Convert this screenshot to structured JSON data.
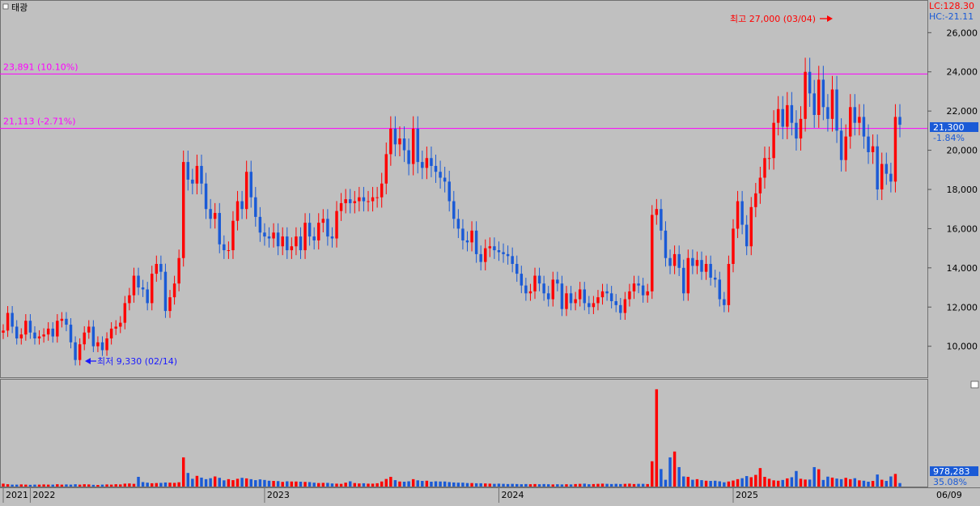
{
  "title": "태광",
  "top_right": {
    "lc": "LC:128.30",
    "hc": "HC:-21.11"
  },
  "current": {
    "price": "21,300",
    "change": "-1.84%"
  },
  "volume_label": "978,283",
  "volume_pct": "35.08%",
  "date_label": "06/09",
  "h_lines": [
    {
      "label": "23,891 (10.10%)",
      "value": 23891
    },
    {
      "label": "21,113 (-2.71%)",
      "value": 21113
    }
  ],
  "annotations": {
    "high": "최고 27,000 (03/04)",
    "low": "최저 9,330 (02/14)"
  },
  "colors": {
    "up": "#ff0000",
    "down": "#1a5ad6",
    "hline": "#ff00ff",
    "axis_text": "#000000",
    "bg": "#c0c0c0"
  },
  "chart_data": {
    "type": "candlestick",
    "price_axis": {
      "min": 8500,
      "max": 27500,
      "ticks": [
        10000,
        12000,
        14000,
        16000,
        18000,
        20000,
        22000,
        24000,
        26000
      ],
      "tick_labels": [
        "10,000",
        "12,000",
        "14,000",
        "16,000",
        "18,000",
        "20,000",
        "22,000",
        "24,000",
        "26,000"
      ]
    },
    "x_axis_labels": [
      "2021",
      "2022",
      "2023",
      "2024",
      "2025"
    ],
    "weeks_per_year": 52,
    "first_week_of_2021_shown": 46,
    "closes": [
      10800,
      11700,
      11000,
      10400,
      10600,
      11300,
      10700,
      10400,
      10500,
      10600,
      10900,
      10500,
      11300,
      11400,
      11100,
      10200,
      9300,
      10100,
      10700,
      11000,
      10000,
      10200,
      9800,
      10400,
      10900,
      11000,
      11200,
      12200,
      12600,
      13600,
      13000,
      12900,
      12200,
      13700,
      14200,
      13800,
      11800,
      12500,
      13200,
      14500,
      19400,
      18500,
      18300,
      19200,
      18300,
      17000,
      16500,
      16800,
      15200,
      14900,
      14900,
      16400,
      17400,
      17000,
      18900,
      17600,
      16600,
      15800,
      15600,
      15500,
      15800,
      15100,
      15600,
      14900,
      15100,
      15600,
      14900,
      16300,
      15600,
      15400,
      16300,
      16500,
      15600,
      15500,
      16900,
      17300,
      17500,
      17300,
      17400,
      17600,
      17400,
      17400,
      17600,
      17600,
      18300,
      19800,
      21100,
      20300,
      20600,
      20000,
      19300,
      21100,
      19400,
      19100,
      19600,
      19200,
      18900,
      18600,
      18400,
      17400,
      16500,
      16000,
      15400,
      15300,
      15900,
      14700,
      14300,
      15000,
      15100,
      14900,
      14800,
      14700,
      14600,
      14200,
      13700,
      13100,
      12700,
      12800,
      13600,
      13200,
      12700,
      12400,
      13400,
      13200,
      11900,
      12700,
      12200,
      12400,
      12900,
      12200,
      12000,
      12200,
      12500,
      12800,
      12700,
      12300,
      12100,
      11700,
      12400,
      12800,
      13200,
      13100,
      12600,
      12800,
      16700,
      17000,
      15900,
      14500,
      14100,
      14700,
      14000,
      12700,
      14500,
      14100,
      14400,
      13800,
      14200,
      13500,
      13400,
      12400,
      12100,
      14200,
      16000,
      17400,
      16200,
      15100,
      17100,
      17800,
      18600,
      19600,
      19600,
      21400,
      22100,
      21200,
      22300,
      21400,
      20600,
      21600,
      24000,
      22900,
      21800,
      23600,
      22200,
      21600,
      23100,
      21000,
      19500,
      20700,
      22200,
      21400,
      21700,
      20700,
      19900,
      20200,
      18000,
      19300,
      18800,
      18400,
      21700,
      21300
    ],
    "volume_axis": {
      "max": 5200000
    },
    "volumes": [
      150000,
      120000,
      100000,
      100000,
      110000,
      100000,
      90000,
      100000,
      100000,
      110000,
      100000,
      100000,
      120000,
      100000,
      110000,
      100000,
      120000,
      100000,
      120000,
      110000,
      90000,
      80000,
      100000,
      110000,
      100000,
      120000,
      110000,
      150000,
      160000,
      140000,
      500000,
      230000,
      200000,
      170000,
      180000,
      190000,
      210000,
      200000,
      190000,
      220000,
      1500000,
      700000,
      400000,
      550000,
      460000,
      380000,
      430000,
      520000,
      450000,
      320000,
      380000,
      330000,
      400000,
      450000,
      420000,
      380000,
      330000,
      370000,
      340000,
      300000,
      290000,
      280000,
      240000,
      270000,
      260000,
      260000,
      250000,
      240000,
      230000,
      200000,
      180000,
      190000,
      190000,
      160000,
      150000,
      140000,
      200000,
      270000,
      180000,
      160000,
      170000,
      150000,
      150000,
      170000,
      260000,
      390000,
      500000,
      330000,
      260000,
      250000,
      270000,
      380000,
      320000,
      290000,
      300000,
      250000,
      270000,
      260000,
      260000,
      230000,
      210000,
      200000,
      200000,
      180000,
      180000,
      170000,
      170000,
      160000,
      150000,
      140000,
      150000,
      140000,
      130000,
      140000,
      130000,
      120000,
      130000,
      120000,
      130000,
      120000,
      130000,
      120000,
      110000,
      120000,
      110000,
      120000,
      110000,
      130000,
      140000,
      150000,
      120000,
      130000,
      140000,
      150000,
      140000,
      130000,
      140000,
      130000,
      140000,
      150000,
      130000,
      140000,
      140000,
      130000,
      1300000,
      5000000,
      900000,
      350000,
      1500000,
      1800000,
      1000000,
      520000,
      500000,
      350000,
      380000,
      330000,
      300000,
      290000,
      300000,
      270000,
      220000,
      260000,
      310000,
      380000,
      430000,
      540000,
      480000,
      600000,
      950000,
      500000,
      400000,
      320000,
      300000,
      340000,
      420000,
      480000,
      800000,
      400000,
      360000,
      360000,
      1000000,
      890000,
      340000,
      510000,
      460000,
      410000,
      380000,
      450000,
      380000,
      430000,
      320000,
      300000,
      250000,
      290000,
      620000,
      350000,
      290000,
      520000,
      650000,
      180000
    ]
  }
}
